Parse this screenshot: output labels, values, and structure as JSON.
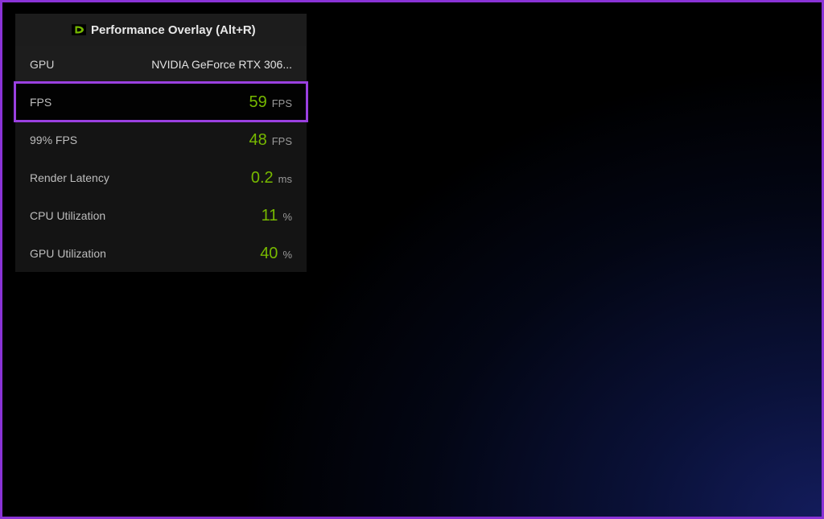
{
  "overlay": {
    "title": "Performance Overlay (Alt+R)",
    "gpu_label": "GPU",
    "gpu_value": "NVIDIA GeForce RTX 306...",
    "rows": [
      {
        "label": "FPS",
        "value": "59",
        "unit": "FPS",
        "highlight": true
      },
      {
        "label": "99% FPS",
        "value": "48",
        "unit": "FPS",
        "highlight": false
      },
      {
        "label": "Render Latency",
        "value": "0.2",
        "unit": "ms",
        "highlight": false
      },
      {
        "label": "CPU Utilization",
        "value": "11",
        "unit": "%",
        "highlight": false
      },
      {
        "label": "GPU Utilization",
        "value": "40",
        "unit": "%",
        "highlight": false
      }
    ]
  },
  "colors": {
    "accent_green": "#77b900",
    "highlight_purple": "#9a40e0",
    "border_purple": "#8a33d6"
  }
}
